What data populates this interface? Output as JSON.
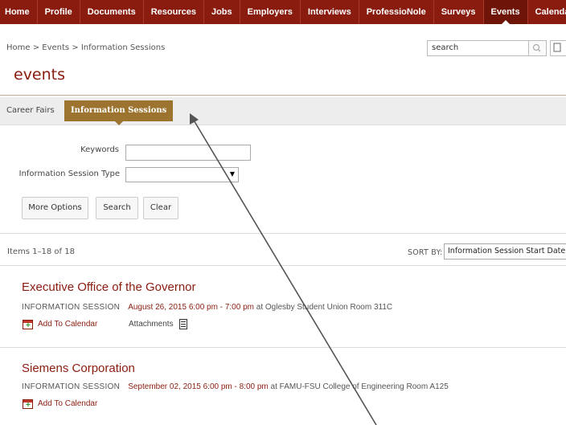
{
  "nav": {
    "items": [
      {
        "label": "Home"
      },
      {
        "label": "Profile"
      },
      {
        "label": "Documents"
      },
      {
        "label": "Resources"
      },
      {
        "label": "Jobs"
      },
      {
        "label": "Employers"
      },
      {
        "label": "Interviews"
      },
      {
        "label": "ProfessioNole"
      },
      {
        "label": "Surveys"
      },
      {
        "label": "Events"
      },
      {
        "label": "Calendar"
      }
    ],
    "active": "Events",
    "brand_color": "#8a1c0f"
  },
  "breadcrumb": "Home > Events > Information Sessions",
  "search": {
    "value": "search",
    "icon": "search-icon"
  },
  "page_title": "events",
  "tabs": [
    {
      "label": "Career Fairs"
    },
    {
      "label": "Information Sessions",
      "selected": true
    }
  ],
  "form": {
    "keywords_label": "Keywords",
    "keywords_value": "",
    "type_label": "Information Session Type",
    "type_value": "",
    "more_options": "More Options",
    "search": "Search",
    "clear": "Clear"
  },
  "results": {
    "items_label": "Items 1–18 of 18",
    "sort_label": "SORT BY:",
    "sort_value": "Information Session Start Date"
  },
  "events": [
    {
      "name": "Executive Office of the Governor",
      "type": "INFORMATION SESSION",
      "date": "August 26, 2015 6:00 pm - 7:00 pm",
      "location": " at Oglesby Student Union Room 311C",
      "add_to_calendar": "Add To Calendar",
      "attachments": "Attachments"
    },
    {
      "name": "Siemens Corporation",
      "type": "INFORMATION SESSION",
      "date": "September 02, 2015 6:00 pm - 8:00 pm",
      "location": " at FAMU-FSU College of Engineering Room A125",
      "add_to_calendar": "Add To Calendar"
    }
  ]
}
